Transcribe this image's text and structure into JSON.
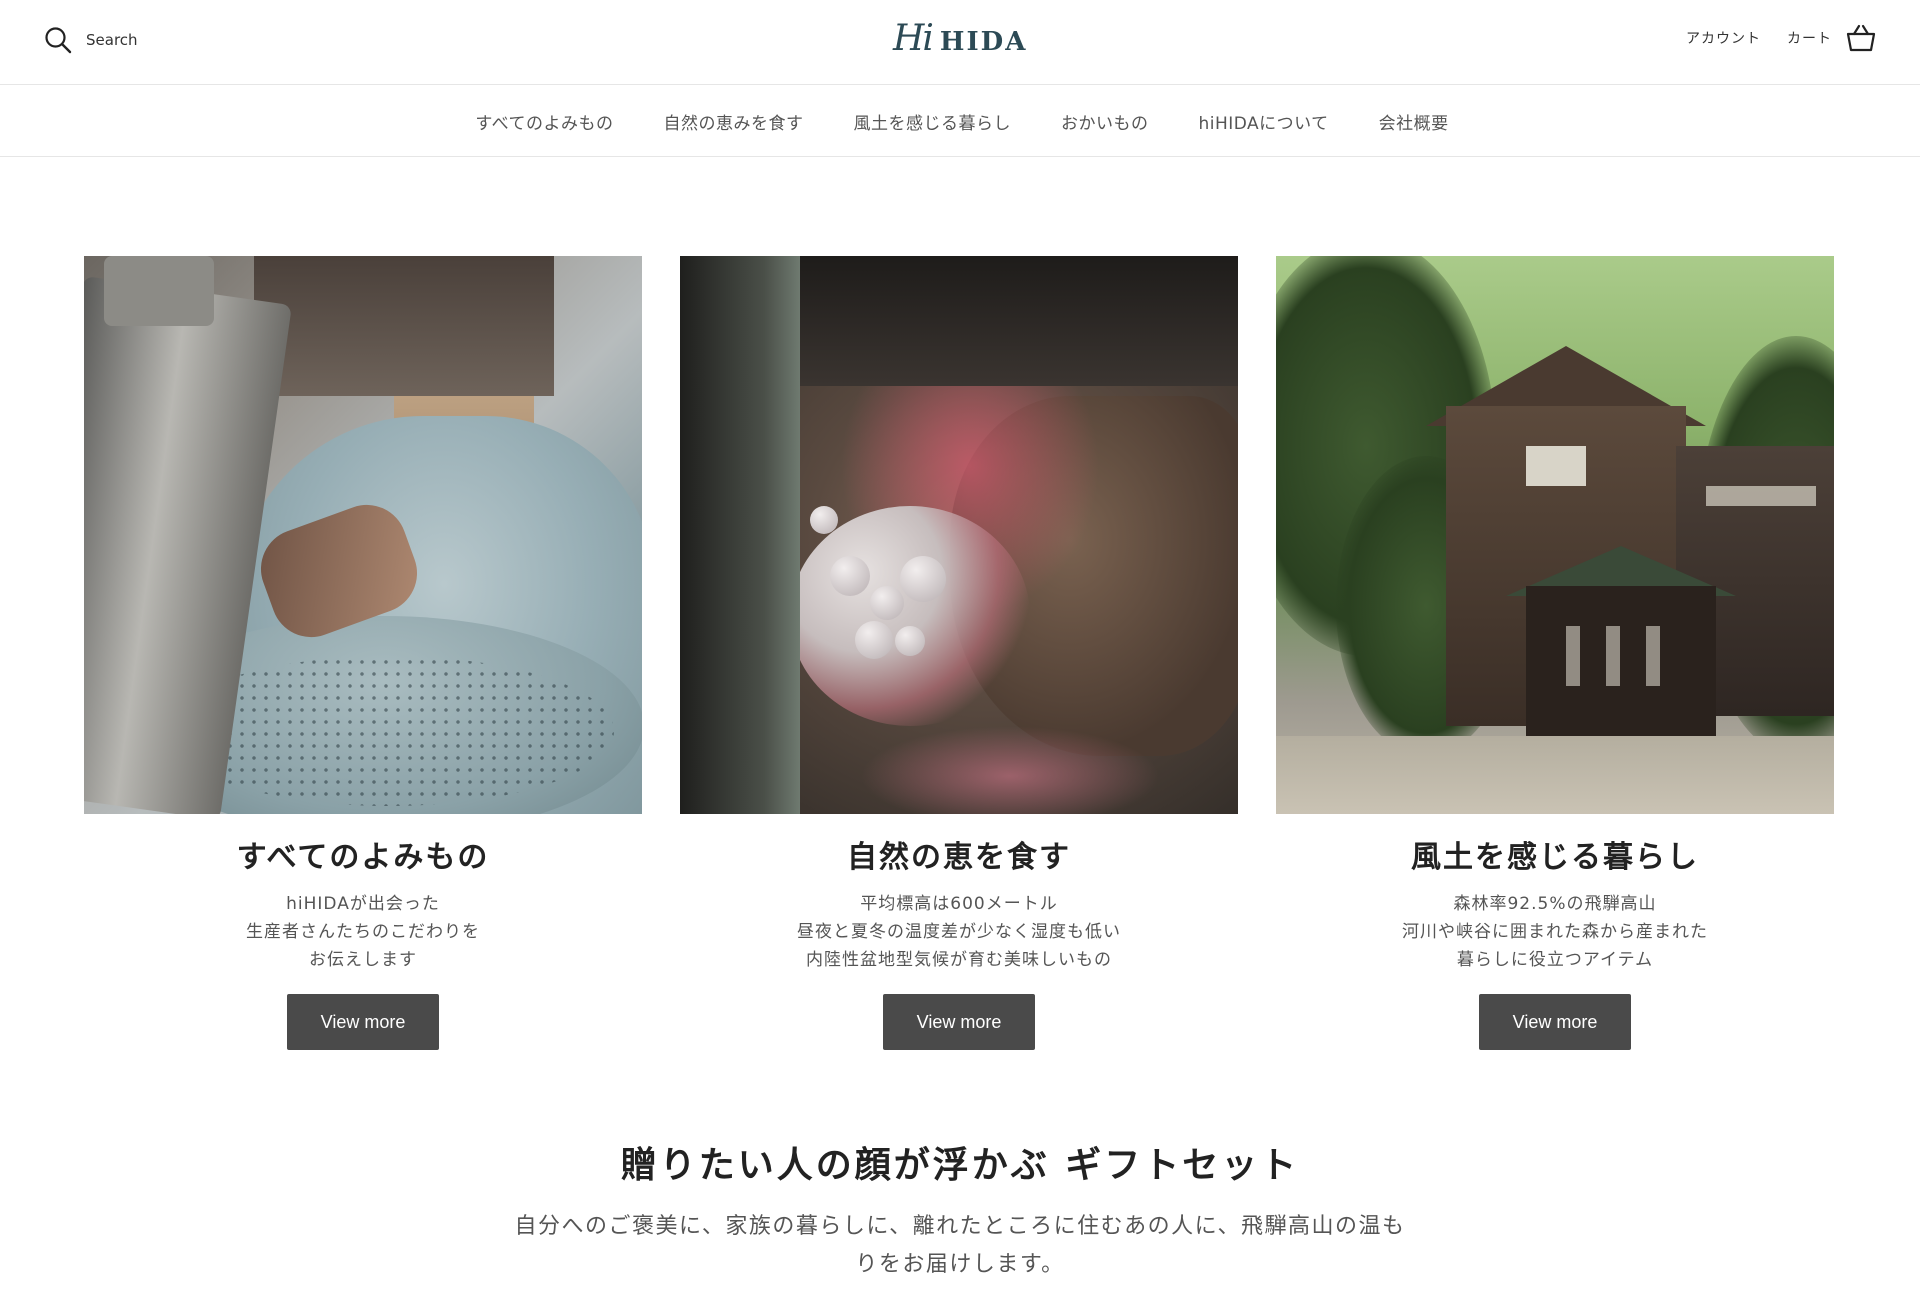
{
  "header": {
    "search_label": "Search",
    "logo_hi": "Hi",
    "logo_hida": "HIDA",
    "account_label": "アカウント",
    "cart_label": "カート"
  },
  "nav": {
    "items": [
      {
        "label": "すべてのよみもの"
      },
      {
        "label": "自然の恵みを食す"
      },
      {
        "label": "風土を感じる暮らし"
      },
      {
        "label": "おかいもの"
      },
      {
        "label": "hiHIDAについて"
      },
      {
        "label": "会社概要"
      }
    ]
  },
  "cards": [
    {
      "title": "すべてのよみもの",
      "desc": [
        "hiHIDAが出会った",
        "生産者さんたちのこだわりを",
        "お伝えします"
      ],
      "button": "View more",
      "image": "sewing-craft-photo"
    },
    {
      "title": "自然の恵を食す",
      "desc": [
        "平均標高は600メートル",
        "昼夜と夏冬の温度差が少なく湿度も低い",
        "内陸性盆地型気候が育む美味しいもの"
      ],
      "button": "View more",
      "image": "fungi-closeup-photo"
    },
    {
      "title": "風土を感じる暮らし",
      "desc": [
        "森林率92.5%の飛騨高山",
        "河川や峡谷に囲まれた森から産まれた",
        "暮らしに役立つアイテム"
      ],
      "button": "View more",
      "image": "forest-house-photo"
    }
  ],
  "gift": {
    "title": "贈りたい人の顔が浮かぶ ギフトセット",
    "desc_line1": "自分へのご褒美に、家族の暮らしに、離れたところに住むあの人に、飛騨高山の温も",
    "desc_line2": "りをお届けします。"
  },
  "colors": {
    "logo": "#2c4a55",
    "button_bg": "#4a4a4a",
    "button_text": "#ffffff",
    "divider": "#e6e6e6"
  }
}
